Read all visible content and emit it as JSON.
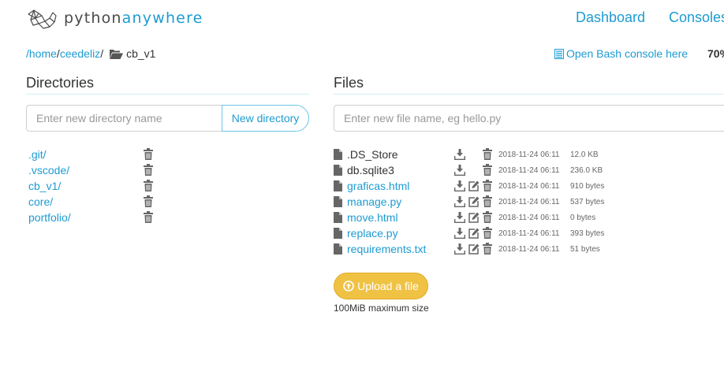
{
  "brand": {
    "part1": "python",
    "part2": "anywhere"
  },
  "nav": {
    "dashboard": "Dashboard",
    "consoles": "Consoles"
  },
  "breadcrumb": {
    "root": "/home",
    "user": "ceedeliz",
    "current": "cb_v1"
  },
  "bash_link": "Open Bash console here",
  "zoom": "70%",
  "directories": {
    "title": "Directories",
    "placeholder": "Enter new directory name",
    "button": "New directory",
    "items": [
      {
        "name": ".git/"
      },
      {
        "name": ".vscode/"
      },
      {
        "name": "cb_v1/"
      },
      {
        "name": "core/"
      },
      {
        "name": "portfolio/"
      }
    ]
  },
  "files": {
    "title": "Files",
    "placeholder": "Enter new file name, eg hello.py",
    "items": [
      {
        "name": ".DS_Store",
        "date": "2018-11-24 06:11",
        "size": "12.0 KB",
        "editable": false
      },
      {
        "name": "db.sqlite3",
        "date": "2018-11-24 06:11",
        "size": "236.0 KB",
        "editable": false
      },
      {
        "name": "graficas.html",
        "date": "2018-11-24 06:11",
        "size": "910 bytes",
        "editable": true
      },
      {
        "name": "manage.py",
        "date": "2018-11-24 06:11",
        "size": "537 bytes",
        "editable": true
      },
      {
        "name": "move.html",
        "date": "2018-11-24 06:11",
        "size": "0 bytes",
        "editable": true
      },
      {
        "name": "replace.py",
        "date": "2018-11-24 06:11",
        "size": "393 bytes",
        "editable": true
      },
      {
        "name": "requirements.txt",
        "date": "2018-11-24 06:11",
        "size": "51 bytes",
        "editable": true
      }
    ],
    "upload_button": "Upload a file",
    "upload_note": "100MiB maximum size"
  },
  "colors": {
    "accent": "#1d9bd1",
    "upload": "#f0c244"
  }
}
